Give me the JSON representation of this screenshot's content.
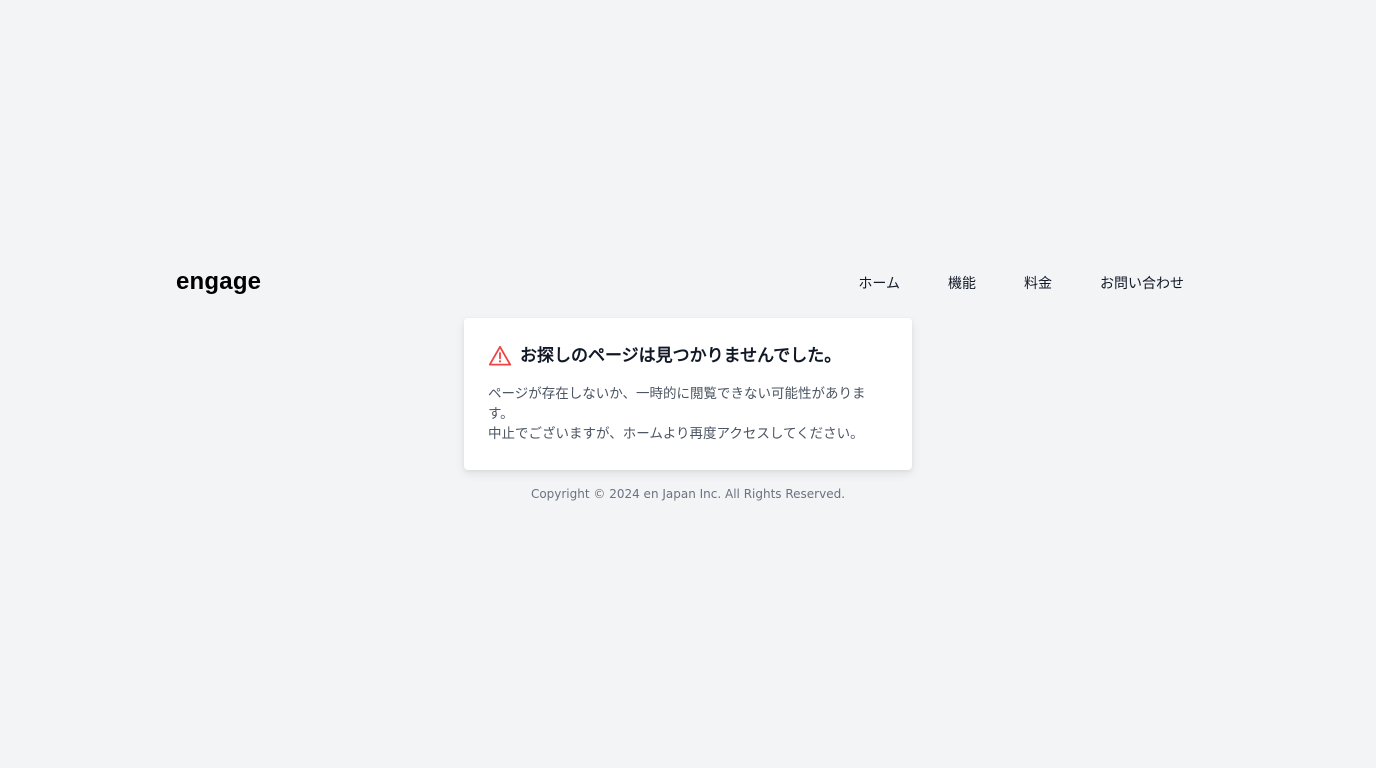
{
  "header": {
    "logo": "engage",
    "nav": [
      {
        "label": "ホーム"
      },
      {
        "label": "機能"
      },
      {
        "label": "料金"
      },
      {
        "label": "お問い合わせ"
      }
    ]
  },
  "error_card": {
    "icon": "warning-triangle-icon",
    "icon_color": "#ef4444",
    "title": "お探しのページは見つかりませんでした。",
    "line1": "ページが存在しないか、一時的に閲覧できない可能性があります。",
    "line2": "中止でございますが、ホームより再度アクセスしてください。"
  },
  "footer": {
    "copyright": "Copyright © 2024 en Japan Inc. All Rights Reserved."
  },
  "colors": {
    "background": "#f3f4f6",
    "card": "#ffffff",
    "text": "#111827",
    "muted": "#4b5563"
  }
}
